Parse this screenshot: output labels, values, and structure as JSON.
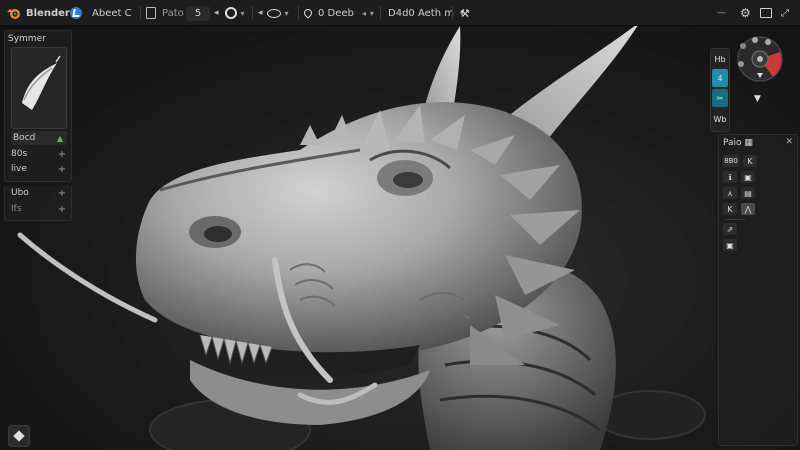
{
  "app": {
    "name": "Blender"
  },
  "toolbar": {
    "mode_label": "Abeet C",
    "brush_label": "Pato",
    "value": "5",
    "falloff_label": "0 Deeb",
    "section_label": "D4d0 Aeth m"
  },
  "window_controls": {
    "minimize": "—",
    "maximize": "☐"
  },
  "header_icons": [
    "settings-icon",
    "screen-icon",
    "fullscreen-icon"
  ],
  "left_panel": {
    "title": "Symmer",
    "rows": [
      {
        "label": "Bocd",
        "action": "▲"
      },
      {
        "label": "80s",
        "action": "+"
      },
      {
        "label": "live",
        "action": "+"
      },
      {
        "label": "Ubo",
        "action": "+"
      },
      {
        "label": "Ifs",
        "action": "+"
      }
    ]
  },
  "nav_column": {
    "items": [
      {
        "label": "Hb"
      },
      {
        "label": "4"
      },
      {
        "label": "✂"
      },
      {
        "label": "Wb"
      }
    ]
  },
  "right_panel": {
    "title": "Paio ▦",
    "close": "✕",
    "rows": [
      [
        "8B0",
        "K"
      ],
      [
        "ℹ",
        "▣"
      ],
      [
        "⋏",
        "▤"
      ],
      [
        "K",
        "⋀"
      ],
      [
        "⇗",
        "▣"
      ]
    ]
  },
  "colors": {
    "accent_blue": "#2a7fd4",
    "teal": "#1f8fa3",
    "gizmo_red": "#c83b3b",
    "logo_orange": "#e98a1f",
    "add_green": "#5fbf4b"
  }
}
